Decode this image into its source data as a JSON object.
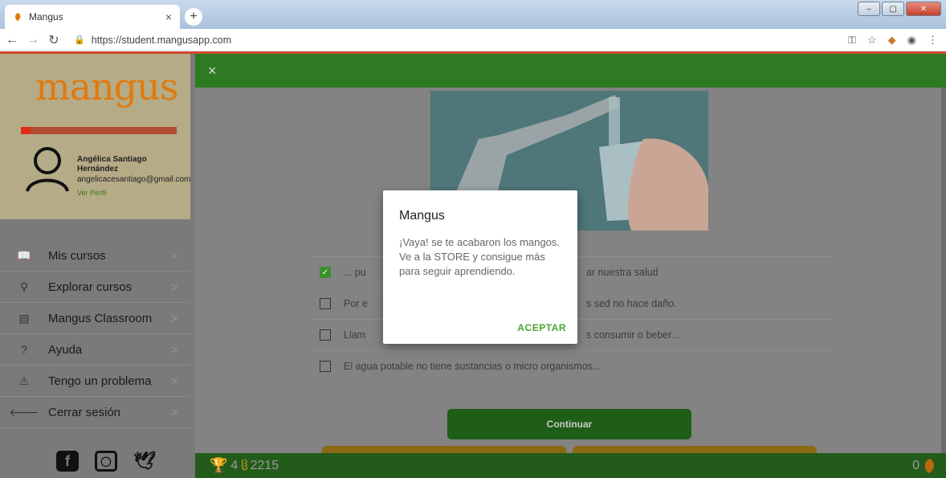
{
  "browser": {
    "tab_title": "Mangus",
    "tab_close": "×",
    "new_tab": "+",
    "url": "https://student.mangusapp.com",
    "window_buttons": [
      "–",
      "▢",
      "✕"
    ]
  },
  "sidebar": {
    "logo": "mangus",
    "user_name": "Angélica Santiago Hernández",
    "user_email": "angelicacesantiago@gmail.com",
    "view_profile": "Ver Perfil",
    "items": [
      {
        "icon": "book-icon",
        "glyph": "📖",
        "label": "Mis cursos"
      },
      {
        "icon": "search-icon",
        "glyph": "⚲",
        "label": "Explorar cursos"
      },
      {
        "icon": "classroom-icon",
        "glyph": "▤",
        "label": "Mangus Classroom"
      },
      {
        "icon": "help-icon",
        "glyph": "?",
        "label": "Ayuda"
      },
      {
        "icon": "warning-icon",
        "glyph": "⚠",
        "label": "Tengo un problema"
      },
      {
        "icon": "logout-icon",
        "glyph": "🡐",
        "label": "Cerrar sesión"
      }
    ],
    "chevron": ">"
  },
  "main": {
    "close": "×",
    "options": [
      {
        "checked": true,
        "left": "... pu",
        "right": "ar nuestra salud"
      },
      {
        "checked": false,
        "left": "Por e",
        "right": "s sed no hace daño."
      },
      {
        "checked": false,
        "left": "Llam",
        "right": "s consumir o beber..."
      },
      {
        "checked": false,
        "left": "El agua potable no tiene sustancias o micro organismos...",
        "right": ""
      }
    ],
    "continue_label": "Continuar",
    "trophies": "4",
    "points": "2215",
    "mangos": "0"
  },
  "modal": {
    "title": "Mangus",
    "body": "¡Vaya! se te acabaron los mangos. Ve a la STORE y consigue más para seguir aprendiendo.",
    "button": "ACEPTAR"
  },
  "colors": {
    "green": "#2e7a23",
    "accent_green": "#4aa532",
    "orange": "#e07a10",
    "red": "#d04a2f"
  }
}
